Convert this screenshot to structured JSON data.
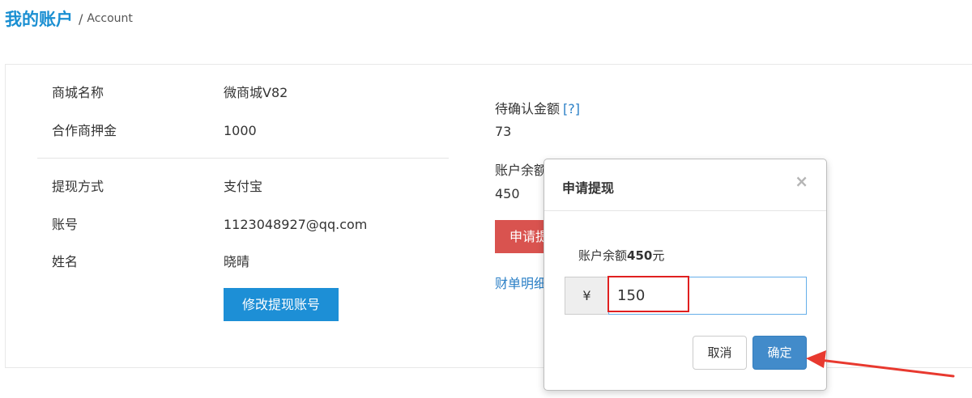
{
  "header": {
    "title": "我的账户",
    "separator": "/",
    "subtitle": "Account"
  },
  "shop_info": {
    "name_label": "商城名称",
    "name_value": "微商城V82",
    "deposit_label": "合作商押金",
    "deposit_value": "1000"
  },
  "withdraw_account": {
    "method_label": "提现方式",
    "method_value": "支付宝",
    "account_label": "账号",
    "account_value": "1123048927@qq.com",
    "holder_label": "姓名",
    "holder_value": "晓晴",
    "edit_button": "修改提现账号"
  },
  "balance_panel": {
    "pending_label": "待确认金额",
    "pending_help": "[?]",
    "pending_value": "73",
    "balance_label": "账户余额",
    "balance_value": "450",
    "apply_button": "申请提现",
    "ledger_link": "财单明细"
  },
  "modal": {
    "title": "申请提现",
    "close_glyph": "×",
    "balance_prefix": "账户余额",
    "balance_amount": "450",
    "balance_suffix": "元",
    "currency_symbol": "¥",
    "amount_value": "150",
    "cancel_button": "取消",
    "confirm_button": "确定"
  },
  "colors": {
    "brand_blue": "#1a8fd2",
    "danger_red": "#d9534f",
    "primary_blue": "#428bca",
    "annotation_red": "#e02020"
  }
}
